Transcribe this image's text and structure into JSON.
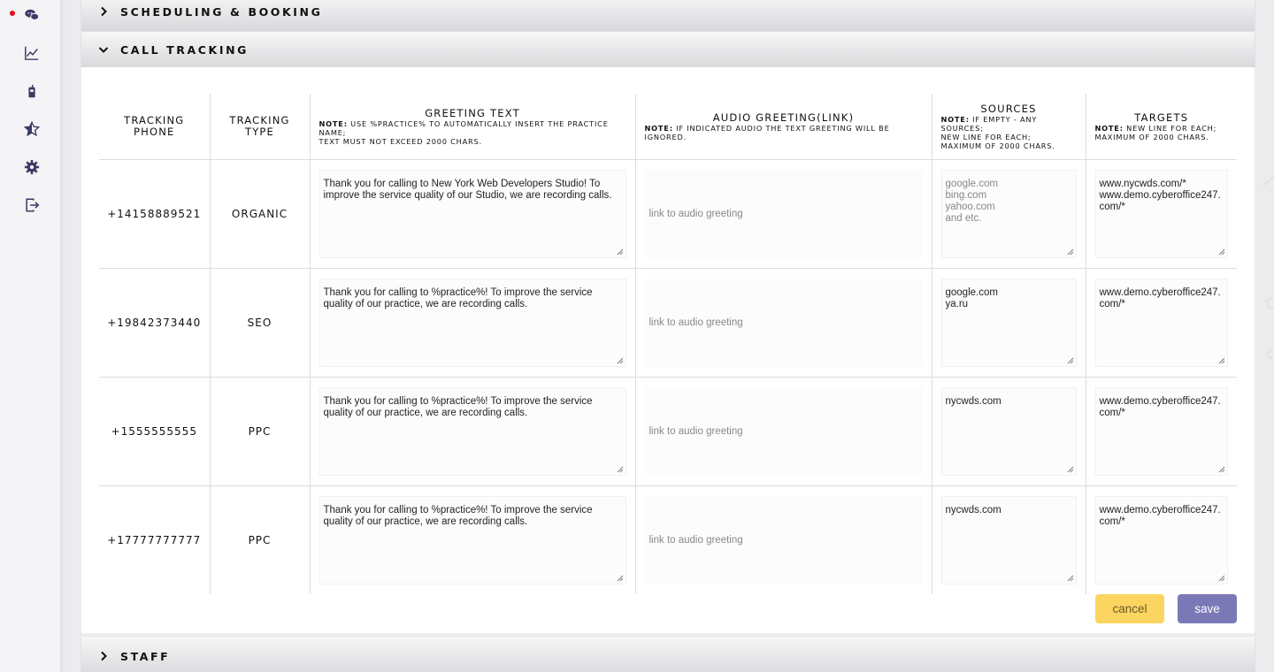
{
  "colors": {
    "accent_save": "#7b78b6",
    "accent_cancel": "#fbd560",
    "notification_dot": "#e0101c",
    "sidebar_icon": "#3a3a66"
  },
  "sidebar": {
    "items": [
      {
        "icon": "chat-bubbles-icon"
      },
      {
        "icon": "line-chart-icon"
      },
      {
        "icon": "mobile-phone-icon"
      },
      {
        "icon": "star-half-icon"
      },
      {
        "icon": "gear-icon"
      },
      {
        "icon": "logout-icon"
      }
    ]
  },
  "sections": {
    "scheduling": "SCHEDULING & BOOKING",
    "call_tracking": "CALL TRACKING",
    "staff": "STAFF"
  },
  "table": {
    "headers": {
      "tracking_phone": "TRACKING PHONE",
      "tracking_type": "TRACKING TYPE",
      "greeting_text": "GREETING TEXT",
      "greeting_note_label": "NOTE:",
      "greeting_note": " USE %PRACTICE% TO AUTOMATICALLY INSERT THE PRACTICE NAME;",
      "greeting_note2": "TEXT MUST NOT EXCEED 2000 CHARS.",
      "audio": "AUDIO GREETING(LINK)",
      "audio_note_label": "NOTE:",
      "audio_note": " IF INDICATED AUDIO THE TEXT GREETING WILL BE IGNORED.",
      "sources": "SOURCES",
      "sources_note_label": "NOTE:",
      "sources_note": " IF EMPTY - ANY SOURCES;",
      "sources_note2": "NEW LINE FOR EACH;",
      "sources_note3": "MAXIMUM OF 2000 CHARS.",
      "targets": "TARGETS",
      "targets_note_label": "NOTE:",
      "targets_note": " NEW LINE FOR EACH;",
      "targets_note2": "MAXIMUM OF 2000 CHARS."
    },
    "rows": [
      {
        "phone": "+14158889521",
        "type": "ORGANIC",
        "greeting": "Thank you for calling to New York Web Developers Studio! To improve the service quality of our Studio, we are recording calls.",
        "audio_placeholder": "link to audio greeting",
        "sources_placeholder": "google.com\nbing.com\nyahoo.com\nand etc.",
        "sources": "",
        "targets": "www.nycwds.com/*\nwww.demo.cyberoffice247.com/*"
      },
      {
        "phone": "+19842373440",
        "type": "SEO",
        "greeting": "Thank you for calling to %practice%! To improve the service quality of our practice, we are recording calls.",
        "audio_placeholder": "link to audio greeting",
        "sources_placeholder": "",
        "sources": "google.com\nya.ru",
        "targets": "www.demo.cyberoffice247.com/*"
      },
      {
        "phone": "+1555555555",
        "type": "PPC",
        "greeting": "Thank you for calling to %practice%! To improve the service quality of our practice, we are recording calls.",
        "audio_placeholder": "link to audio greeting",
        "sources_placeholder": "",
        "sources": "nycwds.com",
        "targets": "www.demo.cyberoffice247.com/*"
      },
      {
        "phone": "+17777777777",
        "type": "PPC",
        "greeting": "Thank you for calling to %practice%! To improve the service quality of our practice, we are recording calls.",
        "audio_placeholder": "link to audio greeting",
        "sources_placeholder": "",
        "sources": "nycwds.com",
        "targets": "www.demo.cyberoffice247.com/*"
      }
    ]
  },
  "buttons": {
    "cancel": "cancel",
    "save": "save"
  }
}
